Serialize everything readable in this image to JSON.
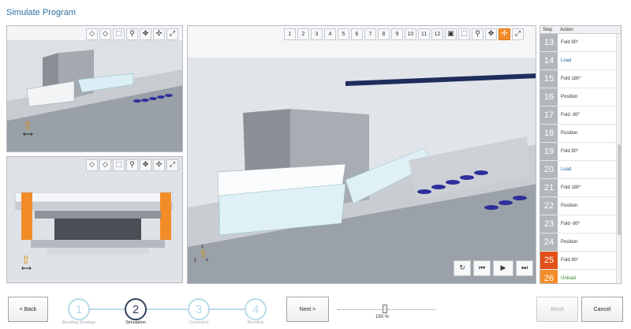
{
  "window": {
    "title": "Simulate Program"
  },
  "viewport_top_left": {
    "tools": [
      "fit-left",
      "fit-right",
      "zoom-window",
      "zoom",
      "pan",
      "rotate",
      "fullscreen"
    ]
  },
  "viewport_bottom_left": {
    "tools": [
      "fit-left",
      "fit-right",
      "zoom-window",
      "zoom",
      "pan",
      "rotate",
      "fullscreen"
    ]
  },
  "viewport_main": {
    "numbers": [
      "1",
      "2",
      "3",
      "4",
      "5",
      "6",
      "7",
      "8",
      "9",
      "10",
      "11",
      "12"
    ],
    "tools": [
      "layout",
      "zoom-window",
      "zoom",
      "pan",
      "rotate-active",
      "fullscreen"
    ],
    "playback": {
      "reset": "↻",
      "prev": "⏮",
      "play": "▶",
      "next": "⏭"
    },
    "axis": {
      "z": "z",
      "y": "y",
      "x": "x"
    }
  },
  "small_axes": {
    "top": {
      "z": "z"
    },
    "bottom": {
      "z": "z",
      "x": "x"
    }
  },
  "steps": {
    "headers": {
      "step": "Step",
      "action": "Action"
    },
    "rows": [
      {
        "n": "13",
        "action": "Fold 90°",
        "style": ""
      },
      {
        "n": "14",
        "action": "Load",
        "style": "blue"
      },
      {
        "n": "15",
        "action": "Fold 180°",
        "style": ""
      },
      {
        "n": "16",
        "action": "Position",
        "style": ""
      },
      {
        "n": "17",
        "action": "Fold -90°",
        "style": ""
      },
      {
        "n": "18",
        "action": "Position",
        "style": ""
      },
      {
        "n": "19",
        "action": "Fold 90°",
        "style": ""
      },
      {
        "n": "20",
        "action": "Load",
        "style": "blue"
      },
      {
        "n": "21",
        "action": "Fold 180°",
        "style": ""
      },
      {
        "n": "22",
        "action": "Position",
        "style": ""
      },
      {
        "n": "23",
        "action": "Fold -90°",
        "style": ""
      },
      {
        "n": "24",
        "action": "Position",
        "style": ""
      },
      {
        "n": "25",
        "action": "Fold 90°",
        "style": "cur"
      },
      {
        "n": "26",
        "action": "Unload",
        "style": "next"
      }
    ]
  },
  "wizard": {
    "back": "< Back",
    "next": "Next >",
    "steps": [
      {
        "num": "1",
        "label": "Bending Strategy",
        "active": false
      },
      {
        "num": "2",
        "label": "Simulation",
        "active": true
      },
      {
        "num": "3",
        "label": "Correction",
        "active": false
      },
      {
        "num": "4",
        "label": "Bending",
        "active": false
      }
    ]
  },
  "zoom": {
    "label": "150 %",
    "level_percent": 150
  },
  "actions": {
    "bend": "Bend",
    "cancel": "Cancel"
  },
  "colors": {
    "accent": "#f28c28",
    "current_step": "#e2501a",
    "wizard_active": "#33425a",
    "wizard_inactive": "#b9dbe9",
    "part_blue": "#2d2f9a"
  }
}
